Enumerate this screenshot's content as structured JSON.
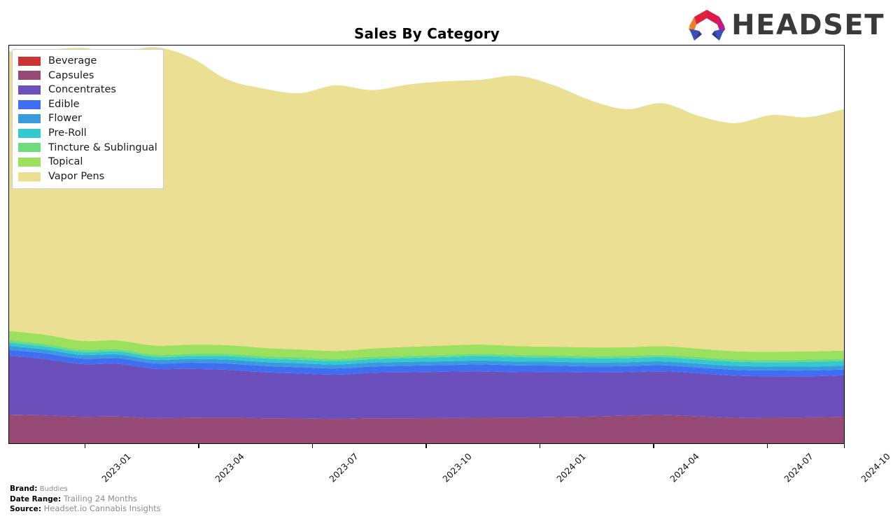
{
  "header": {
    "title": "Sales By Category",
    "logo_text": "HEADSET",
    "logo_icon": "headset-hexagon-logo"
  },
  "footer": {
    "rows": [
      {
        "key": "Brand:",
        "value": "Buddies"
      },
      {
        "key": "Date Range:",
        "value": "Trailing 24 Months"
      },
      {
        "key": "Source:",
        "value": "Headset.io Cannabis Insights"
      }
    ]
  },
  "legend": {
    "position": "top-left",
    "items": [
      {
        "label": "Beverage",
        "color": "#cc3333"
      },
      {
        "label": "Capsules",
        "color": "#984a77"
      },
      {
        "label": "Concentrates",
        "color": "#6b4fbb"
      },
      {
        "label": "Edible",
        "color": "#3f6ef0"
      },
      {
        "label": "Flower",
        "color": "#3a9ade"
      },
      {
        "label": "Pre-Roll",
        "color": "#33c9cf"
      },
      {
        "label": "Tincture & Sublingual",
        "color": "#6edb7e"
      },
      {
        "label": "Topical",
        "color": "#9be05e"
      },
      {
        "label": "Vapor Pens",
        "color": "#ebdf94"
      }
    ]
  },
  "chart_data": {
    "type": "area",
    "stacked": true,
    "title": "Sales By Category",
    "xlabel": "",
    "ylabel": "",
    "grid": false,
    "legend_position": "top-left",
    "x_tick_labels": [
      "2023-01",
      "2023-04",
      "2023-07",
      "2023-10",
      "2024-01",
      "2024-04",
      "2024-07",
      "2024-10"
    ],
    "x_tick_positions_pct": [
      9.1,
      22.7,
      36.3,
      49.9,
      63.5,
      77.1,
      90.7,
      99.9
    ],
    "x": [
      "2022-11",
      "2022-12",
      "2023-01",
      "2023-02",
      "2023-03",
      "2023-04",
      "2023-05",
      "2023-06",
      "2023-07",
      "2023-08",
      "2023-09",
      "2023-10",
      "2023-11",
      "2023-12",
      "2024-01",
      "2024-02",
      "2024-03",
      "2024-04",
      "2024-05",
      "2024-06",
      "2024-07",
      "2024-08",
      "2024-09",
      "2024-10"
    ],
    "ylim": [
      0,
      100
    ],
    "y_units": "percent of total sales",
    "series": [
      {
        "name": "Capsules",
        "color": "#984a77",
        "values": [
          7.2,
          7.2,
          7.2,
          7.1,
          7.0,
          6.8,
          6.6,
          6.4,
          6.3,
          6.3,
          6.4,
          6.5,
          6.6,
          6.7,
          6.8,
          6.8,
          6.9,
          7.2,
          7.4,
          7.0,
          6.6,
          6.6,
          6.7,
          6.9
        ]
      },
      {
        "name": "Concentrates",
        "color": "#6b4fbb",
        "values": [
          14.8,
          14.6,
          14.3,
          14.0,
          13.6,
          12.9,
          12.2,
          11.7,
          11.4,
          11.4,
          11.6,
          11.9,
          12.1,
          12.2,
          12.0,
          11.7,
          11.4,
          11.3,
          11.4,
          11.2,
          10.9,
          10.7,
          10.6,
          10.7
        ]
      },
      {
        "name": "Edible",
        "color": "#3f6ef0",
        "values": [
          1.5,
          1.5,
          1.5,
          1.5,
          1.5,
          1.6,
          1.6,
          1.6,
          1.6,
          1.6,
          1.6,
          1.7,
          1.7,
          1.8,
          1.8,
          1.7,
          1.6,
          1.6,
          1.6,
          1.5,
          1.5,
          1.5,
          1.5,
          1.5
        ]
      },
      {
        "name": "Flower",
        "color": "#3a9ade",
        "values": [
          1.0,
          1.0,
          1.0,
          1.0,
          1.0,
          1.0,
          1.0,
          1.0,
          1.0,
          1.0,
          1.0,
          1.0,
          1.0,
          1.0,
          1.0,
          1.0,
          1.0,
          1.0,
          1.0,
          1.0,
          1.0,
          1.0,
          1.0,
          1.0
        ]
      },
      {
        "name": "Pre-Roll",
        "color": "#33c9cf",
        "values": [
          0.8,
          0.8,
          0.8,
          0.8,
          0.8,
          0.8,
          0.9,
          0.9,
          0.9,
          0.9,
          0.9,
          1.0,
          1.1,
          1.2,
          1.2,
          1.1,
          1.1,
          1.1,
          1.1,
          1.1,
          1.1,
          1.1,
          1.2,
          1.2
        ]
      },
      {
        "name": "Tincture & Sublingual",
        "color": "#6edb7e",
        "values": [
          0.6,
          0.6,
          0.6,
          0.6,
          0.6,
          0.6,
          0.6,
          0.6,
          0.6,
          0.6,
          0.6,
          0.6,
          0.6,
          0.6,
          0.6,
          0.6,
          0.6,
          0.6,
          0.6,
          0.6,
          0.6,
          0.6,
          0.6,
          0.6
        ]
      },
      {
        "name": "Topical",
        "color": "#9be05e",
        "values": [
          2.3,
          2.4,
          2.4,
          2.3,
          2.5,
          2.4,
          2.2,
          2.1,
          2.0,
          2.0,
          2.1,
          2.3,
          2.4,
          2.4,
          2.3,
          2.2,
          2.2,
          2.2,
          2.3,
          2.2,
          2.1,
          2.1,
          2.1,
          2.1
        ]
      },
      {
        "name": "Beverage",
        "color": "#cc3333",
        "values": [
          0.0,
          0.0,
          0.0,
          0.0,
          0.0,
          0.0,
          0.0,
          0.0,
          0.0,
          0.0,
          0.0,
          0.0,
          0.0,
          0.0,
          0.0,
          0.0,
          0.0,
          0.0,
          0.0,
          0.0,
          0.0,
          0.0,
          0.0,
          0.0
        ]
      },
      {
        "name": "Vapor Pens",
        "color": "#ebdf94",
        "values": [
          70.2,
          73.8,
          79.5,
          76.5,
          82.5,
          76.0,
          68.0,
          66.0,
          65.0,
          68.5,
          66.0,
          68.0,
          69.0,
          69.5,
          71.5,
          68.0,
          64.0,
          62.0,
          63.5,
          60.5,
          59.0,
          61.0,
          60.5,
          62.5
        ]
      }
    ],
    "top_boundary_pct": [
      98.5,
      98.9,
      99.4,
      98.2,
      99.6,
      97.0,
      91.5,
      89.2,
      88.0,
      90.0,
      88.8,
      90.2,
      91.0,
      91.4,
      92.4,
      90.0,
      86.3,
      84.0,
      85.5,
      82.3,
      80.5,
      82.5,
      82.0,
      84.0
    ]
  }
}
